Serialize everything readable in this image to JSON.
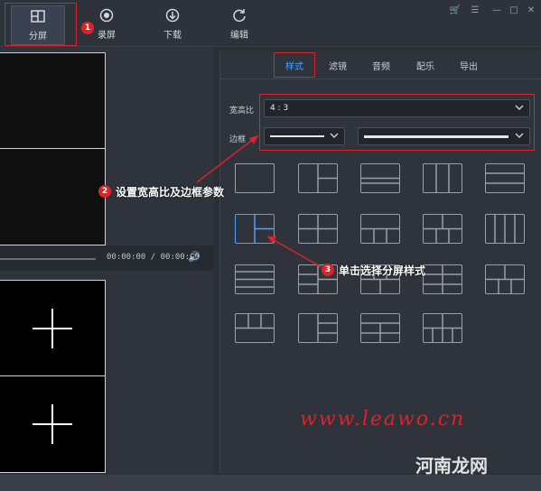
{
  "nav": {
    "items": [
      {
        "label": "分屏",
        "icon": "split-screen-icon"
      },
      {
        "label": "录屏",
        "icon": "record-icon"
      },
      {
        "label": "下载",
        "icon": "download-icon"
      },
      {
        "label": "编辑",
        "icon": "edit-icon"
      }
    ]
  },
  "window_controls": [
    "cart-icon",
    "menu-icon",
    "minimize-icon",
    "maximize-icon",
    "close-icon"
  ],
  "player": {
    "time": "00:00:00 / 00:00:00"
  },
  "tabs": [
    {
      "label": "样式",
      "active": true
    },
    {
      "label": "滤镜",
      "active": false
    },
    {
      "label": "音频",
      "active": false
    },
    {
      "label": "配乐",
      "active": false
    },
    {
      "label": "导出",
      "active": false
    }
  ],
  "settings": {
    "aspect_label": "宽高比",
    "aspect_value": "4 : 3",
    "border_label": "边框"
  },
  "annotations": {
    "one": "1",
    "two": "2",
    "two_text": "设置宽高比及边框参数",
    "three": "3",
    "three_text": "单击选择分屏样式"
  },
  "watermark": {
    "site": "www.leawo.cn",
    "brand": "河南龙网"
  },
  "colors": {
    "accent": "#4aa3ff",
    "annotation_red": "#d9242a"
  },
  "layouts_selected_index": 5
}
